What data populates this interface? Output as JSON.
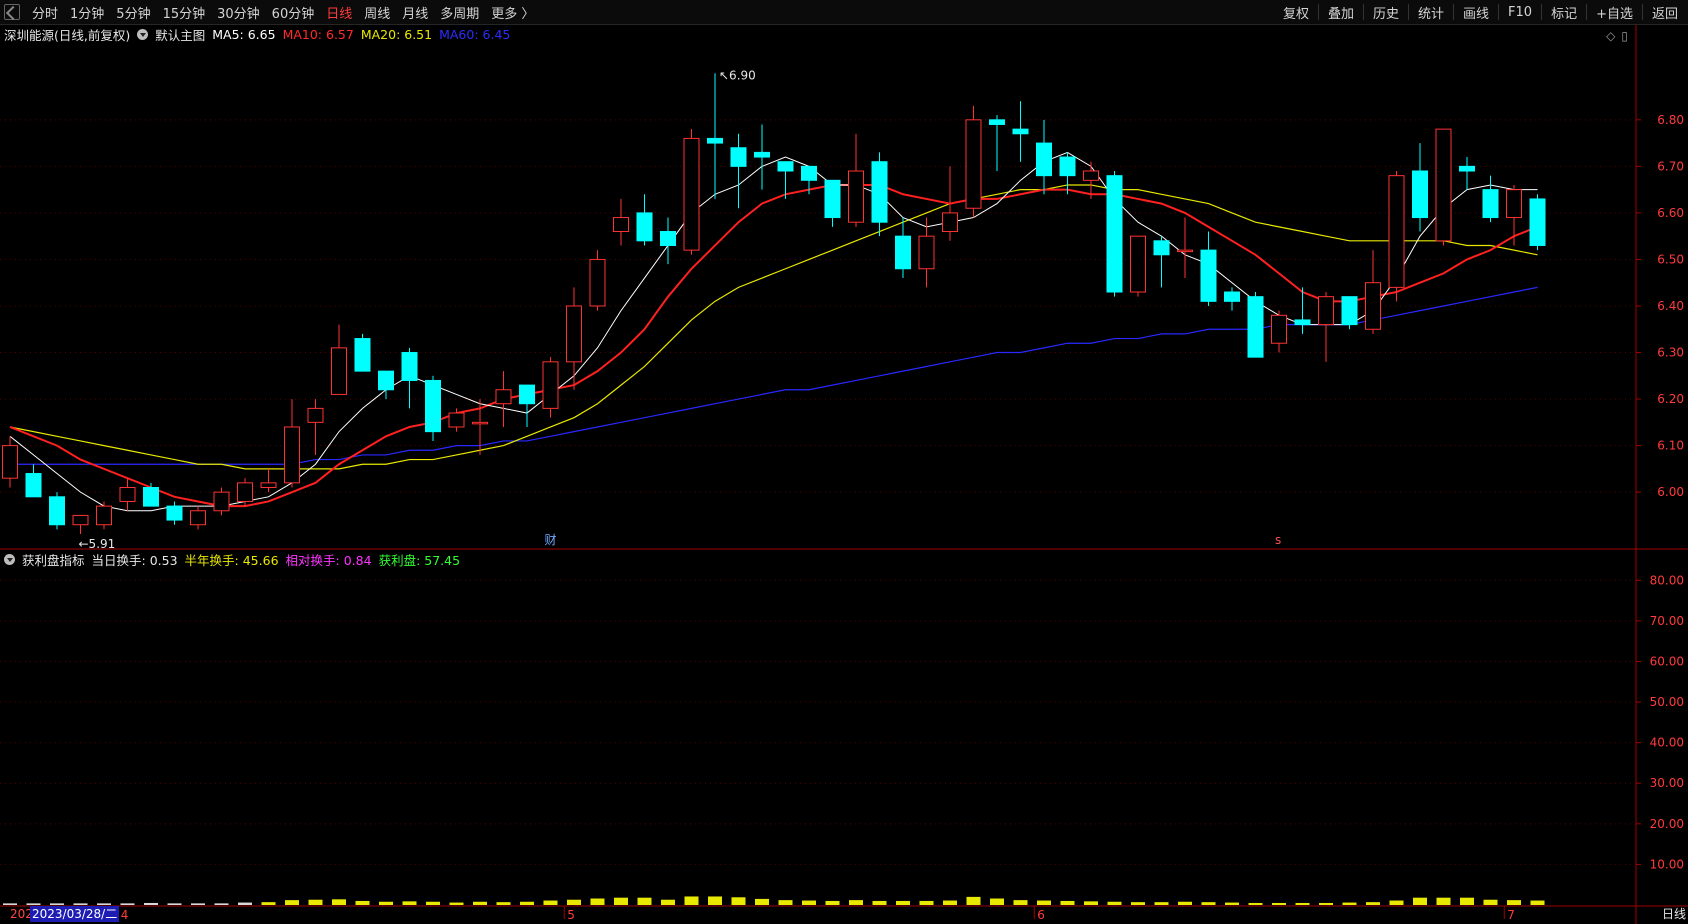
{
  "toolbar": {
    "left_items": [
      "分时",
      "1分钟",
      "5分钟",
      "15分钟",
      "30分钟",
      "60分钟",
      "日线",
      "周线",
      "月线",
      "多周期",
      "更多 〉"
    ],
    "active": "日线",
    "right_items": [
      "复权",
      "叠加",
      "历史",
      "统计",
      "画线",
      "F10",
      "标记",
      "+自选",
      "返回"
    ]
  },
  "main_legend": {
    "name": "深圳能源(日线,前复权)",
    "template": "默认主图",
    "ma5": "MA5: 6.65",
    "ma10": "MA10: 6.57",
    "ma20": "MA20: 6.51",
    "ma60": "MA60: 6.45"
  },
  "sub_legend": {
    "name": "获利盘指标",
    "turnover": "当日换手: 0.53",
    "half_year": "半年换手: 45.66",
    "relative": "相对换手: 0.84",
    "profit": "获利盘: 57.45"
  },
  "markers": {
    "high": "6.90",
    "low": "5.91",
    "fin": "财",
    "s": "s"
  },
  "bottom": {
    "cursor_date": "2023/03/28/二",
    "cut_prefix": "202",
    "period_label": "日线"
  },
  "colors": {
    "up": "#ff3232",
    "down": "#00ffff",
    "ma5": "#ffffff",
    "ma10": "#ff2020",
    "ma20": "#e8e800",
    "ma60": "#2828ff",
    "axis": "#a00000"
  },
  "chart_data": [
    {
      "type": "candlestick",
      "title": "深圳能源(日线,前复权)",
      "y_ticks": [
        6.0,
        6.1,
        6.2,
        6.3,
        6.4,
        6.5,
        6.6,
        6.7,
        6.8
      ],
      "ylim": [
        5.88,
        6.95
      ],
      "month_labels": [
        {
          "i": 5,
          "label": "4"
        },
        {
          "i": 24,
          "label": "5"
        },
        {
          "i": 44,
          "label": "6"
        },
        {
          "i": 64,
          "label": "7"
        }
      ],
      "candles": [
        {
          "o": 6.03,
          "h": 6.12,
          "l": 6.01,
          "c": 6.1
        },
        {
          "o": 6.04,
          "h": 6.06,
          "l": 5.99,
          "c": 5.99
        },
        {
          "o": 5.99,
          "h": 6.0,
          "l": 5.92,
          "c": 5.93
        },
        {
          "o": 5.93,
          "h": 5.95,
          "l": 5.91,
          "c": 5.95
        },
        {
          "o": 5.93,
          "h": 5.98,
          "l": 5.92,
          "c": 5.97
        },
        {
          "o": 5.98,
          "h": 6.03,
          "l": 5.96,
          "c": 6.01
        },
        {
          "o": 6.01,
          "h": 6.02,
          "l": 5.97,
          "c": 5.97
        },
        {
          "o": 5.97,
          "h": 5.98,
          "l": 5.93,
          "c": 5.94
        },
        {
          "o": 5.93,
          "h": 5.97,
          "l": 5.92,
          "c": 5.96
        },
        {
          "o": 5.96,
          "h": 6.01,
          "l": 5.95,
          "c": 6.0
        },
        {
          "o": 5.98,
          "h": 6.03,
          "l": 5.97,
          "c": 6.02
        },
        {
          "o": 6.01,
          "h": 6.05,
          "l": 6.0,
          "c": 6.02
        },
        {
          "o": 6.02,
          "h": 6.2,
          "l": 6.01,
          "c": 6.14
        },
        {
          "o": 6.15,
          "h": 6.2,
          "l": 6.08,
          "c": 6.18
        },
        {
          "o": 6.21,
          "h": 6.36,
          "l": 6.21,
          "c": 6.31
        },
        {
          "o": 6.33,
          "h": 6.34,
          "l": 6.26,
          "c": 6.26
        },
        {
          "o": 6.26,
          "h": 6.24,
          "l": 6.2,
          "c": 6.22
        },
        {
          "o": 6.3,
          "h": 6.31,
          "l": 6.18,
          "c": 6.24
        },
        {
          "o": 6.24,
          "h": 6.25,
          "l": 6.11,
          "c": 6.13
        },
        {
          "o": 6.14,
          "h": 6.18,
          "l": 6.13,
          "c": 6.17
        },
        {
          "o": 6.15,
          "h": 6.2,
          "l": 6.08,
          "c": 6.15
        },
        {
          "o": 6.19,
          "h": 6.26,
          "l": 6.14,
          "c": 6.22
        },
        {
          "o": 6.23,
          "h": 6.23,
          "l": 6.14,
          "c": 6.19
        },
        {
          "o": 6.18,
          "h": 6.29,
          "l": 6.16,
          "c": 6.28
        },
        {
          "o": 6.28,
          "h": 6.44,
          "l": 6.22,
          "c": 6.4
        },
        {
          "o": 6.4,
          "h": 6.52,
          "l": 6.39,
          "c": 6.5
        },
        {
          "o": 6.56,
          "h": 6.63,
          "l": 6.53,
          "c": 6.59
        },
        {
          "o": 6.6,
          "h": 6.64,
          "l": 6.53,
          "c": 6.54
        },
        {
          "o": 6.56,
          "h": 6.59,
          "l": 6.49,
          "c": 6.53
        },
        {
          "o": 6.52,
          "h": 6.78,
          "l": 6.51,
          "c": 6.76
        },
        {
          "o": 6.76,
          "h": 6.9,
          "l": 6.63,
          "c": 6.75
        },
        {
          "o": 6.74,
          "h": 6.77,
          "l": 6.61,
          "c": 6.7
        },
        {
          "o": 6.73,
          "h": 6.79,
          "l": 6.65,
          "c": 6.72
        },
        {
          "o": 6.71,
          "h": 6.7,
          "l": 6.63,
          "c": 6.69
        },
        {
          "o": 6.7,
          "h": 6.69,
          "l": 6.64,
          "c": 6.67
        },
        {
          "o": 6.67,
          "h": 6.67,
          "l": 6.57,
          "c": 6.59
        },
        {
          "o": 6.58,
          "h": 6.77,
          "l": 6.57,
          "c": 6.69
        },
        {
          "o": 6.71,
          "h": 6.73,
          "l": 6.55,
          "c": 6.58
        },
        {
          "o": 6.55,
          "h": 6.59,
          "l": 6.46,
          "c": 6.48
        },
        {
          "o": 6.48,
          "h": 6.59,
          "l": 6.44,
          "c": 6.55
        },
        {
          "o": 6.56,
          "h": 6.7,
          "l": 6.54,
          "c": 6.6
        },
        {
          "o": 6.61,
          "h": 6.83,
          "l": 6.59,
          "c": 6.8
        },
        {
          "o": 6.8,
          "h": 6.81,
          "l": 6.69,
          "c": 6.79
        },
        {
          "o": 6.78,
          "h": 6.84,
          "l": 6.71,
          "c": 6.77
        },
        {
          "o": 6.75,
          "h": 6.8,
          "l": 6.64,
          "c": 6.68
        },
        {
          "o": 6.72,
          "h": 6.73,
          "l": 6.64,
          "c": 6.68
        },
        {
          "o": 6.67,
          "h": 6.71,
          "l": 6.63,
          "c": 6.69
        },
        {
          "o": 6.68,
          "h": 6.69,
          "l": 6.42,
          "c": 6.43
        },
        {
          "o": 6.43,
          "h": 6.55,
          "l": 6.42,
          "c": 6.55
        },
        {
          "o": 6.54,
          "h": 6.55,
          "l": 6.44,
          "c": 6.51
        },
        {
          "o": 6.52,
          "h": 6.59,
          "l": 6.46,
          "c": 6.52
        },
        {
          "o": 6.52,
          "h": 6.56,
          "l": 6.4,
          "c": 6.41
        },
        {
          "o": 6.43,
          "h": 6.44,
          "l": 6.39,
          "c": 6.41
        },
        {
          "o": 6.42,
          "h": 6.43,
          "l": 6.29,
          "c": 6.29
        },
        {
          "o": 6.32,
          "h": 6.39,
          "l": 6.3,
          "c": 6.38
        },
        {
          "o": 6.37,
          "h": 6.44,
          "l": 6.34,
          "c": 6.36
        },
        {
          "o": 6.36,
          "h": 6.43,
          "l": 6.28,
          "c": 6.42
        },
        {
          "o": 6.42,
          "h": 6.42,
          "l": 6.35,
          "c": 6.36
        },
        {
          "o": 6.35,
          "h": 6.52,
          "l": 6.34,
          "c": 6.45
        },
        {
          "o": 6.44,
          "h": 6.69,
          "l": 6.41,
          "c": 6.68
        },
        {
          "o": 6.69,
          "h": 6.75,
          "l": 6.56,
          "c": 6.59
        },
        {
          "o": 6.54,
          "h": 6.78,
          "l": 6.53,
          "c": 6.78
        },
        {
          "o": 6.7,
          "h": 6.72,
          "l": 6.65,
          "c": 6.69
        },
        {
          "o": 6.65,
          "h": 6.68,
          "l": 6.58,
          "c": 6.59
        },
        {
          "o": 6.59,
          "h": 6.66,
          "l": 6.53,
          "c": 6.65
        },
        {
          "o": 6.63,
          "h": 6.64,
          "l": 6.52,
          "c": 6.53
        }
      ],
      "ma5": [
        6.12,
        6.08,
        6.04,
        6.0,
        5.97,
        5.96,
        5.96,
        5.97,
        5.97,
        5.97,
        5.98,
        5.99,
        6.02,
        6.06,
        6.13,
        6.18,
        6.22,
        6.25,
        6.23,
        6.21,
        6.19,
        6.18,
        6.17,
        6.21,
        6.25,
        6.31,
        6.39,
        6.46,
        6.53,
        6.6,
        6.64,
        6.66,
        6.7,
        6.72,
        6.7,
        6.66,
        6.66,
        6.64,
        6.59,
        6.57,
        6.58,
        6.59,
        6.62,
        6.67,
        6.71,
        6.73,
        6.7,
        6.63,
        6.58,
        6.55,
        6.51,
        6.49,
        6.45,
        6.41,
        6.38,
        6.36,
        6.36,
        6.36,
        6.39,
        6.46,
        6.55,
        6.61,
        6.65,
        6.66,
        6.65,
        6.65
      ],
      "ma10": [
        6.14,
        6.12,
        6.1,
        6.07,
        6.05,
        6.03,
        6.01,
        5.99,
        5.98,
        5.97,
        5.97,
        5.98,
        6.0,
        6.02,
        6.06,
        6.09,
        6.12,
        6.14,
        6.15,
        6.17,
        6.18,
        6.2,
        6.21,
        6.22,
        6.23,
        6.26,
        6.3,
        6.35,
        6.42,
        6.48,
        6.53,
        6.58,
        6.62,
        6.64,
        6.65,
        6.66,
        6.66,
        6.66,
        6.64,
        6.63,
        6.62,
        6.63,
        6.63,
        6.64,
        6.65,
        6.65,
        6.64,
        6.64,
        6.63,
        6.62,
        6.6,
        6.57,
        6.54,
        6.51,
        6.47,
        6.43,
        6.41,
        6.41,
        6.42,
        6.43,
        6.45,
        6.47,
        6.5,
        6.52,
        6.55,
        6.57
      ],
      "ma20": [
        6.14,
        6.13,
        6.12,
        6.11,
        6.1,
        6.09,
        6.08,
        6.07,
        6.06,
        6.06,
        6.05,
        6.05,
        6.05,
        6.05,
        6.05,
        6.06,
        6.06,
        6.07,
        6.07,
        6.08,
        6.09,
        6.1,
        6.12,
        6.14,
        6.16,
        6.19,
        6.23,
        6.27,
        6.32,
        6.37,
        6.41,
        6.44,
        6.46,
        6.48,
        6.5,
        6.52,
        6.54,
        6.56,
        6.58,
        6.6,
        6.62,
        6.63,
        6.64,
        6.65,
        6.65,
        6.66,
        6.66,
        6.65,
        6.65,
        6.64,
        6.63,
        6.62,
        6.6,
        6.58,
        6.57,
        6.56,
        6.55,
        6.54,
        6.54,
        6.54,
        6.54,
        6.54,
        6.53,
        6.53,
        6.52,
        6.51
      ],
      "ma60": [
        6.06,
        6.06,
        6.06,
        6.06,
        6.06,
        6.06,
        6.06,
        6.06,
        6.06,
        6.06,
        6.06,
        6.06,
        6.06,
        6.07,
        6.07,
        6.08,
        6.08,
        6.09,
        6.09,
        6.1,
        6.1,
        6.11,
        6.11,
        6.12,
        6.13,
        6.14,
        6.15,
        6.16,
        6.17,
        6.18,
        6.19,
        6.2,
        6.21,
        6.22,
        6.22,
        6.23,
        6.24,
        6.25,
        6.26,
        6.27,
        6.28,
        6.29,
        6.3,
        6.3,
        6.31,
        6.32,
        6.32,
        6.33,
        6.33,
        6.34,
        6.34,
        6.35,
        6.35,
        6.35,
        6.36,
        6.36,
        6.36,
        6.36,
        6.37,
        6.38,
        6.39,
        6.4,
        6.41,
        6.42,
        6.43,
        6.44
      ]
    },
    {
      "type": "bar",
      "title": "获利盘指标",
      "y_ticks": [
        10,
        20,
        30,
        40,
        50,
        60,
        70,
        80
      ],
      "ylim": [
        0,
        85
      ],
      "values": [
        0.4,
        0.4,
        0.4,
        0.4,
        0.4,
        0.4,
        0.5,
        0.4,
        0.4,
        0.4,
        0.6,
        0.7,
        1.2,
        1.3,
        1.4,
        1.0,
        0.8,
        0.9,
        0.8,
        0.6,
        0.8,
        0.7,
        0.8,
        1.1,
        1.3,
        1.6,
        1.8,
        1.8,
        1.3,
        2.1,
        2.1,
        1.9,
        1.5,
        1.2,
        1.1,
        1.0,
        1.2,
        1.0,
        1.0,
        1.0,
        1.1,
        2.0,
        1.6,
        1.2,
        1.1,
        1.0,
        0.9,
        0.8,
        0.7,
        0.7,
        0.8,
        0.7,
        0.6,
        0.5,
        0.5,
        0.5,
        0.5,
        0.6,
        0.7,
        1.1,
        1.8,
        1.8,
        1.8,
        1.3,
        1.2,
        1.1
      ]
    }
  ]
}
